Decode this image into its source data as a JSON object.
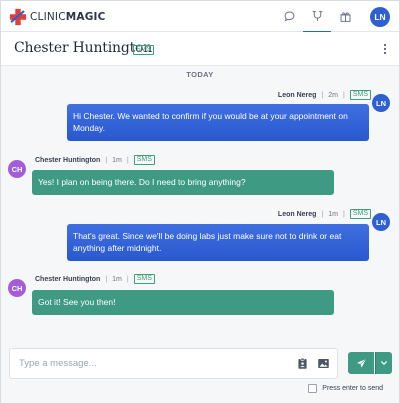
{
  "app": {
    "brand_prefix": "CLINIC",
    "brand_suffix": "MAGIC",
    "user_initials": "LN",
    "colors": {
      "primary": "#2563eb",
      "sms_green": "#3f9a84",
      "incoming_avatar": "#a45dd8"
    }
  },
  "nav": {
    "icons": [
      "chat-icon",
      "stethoscope-icon",
      "gift-icon"
    ],
    "active": "stethoscope-icon"
  },
  "header": {
    "contact_name": "Chester Huntington",
    "channel": "SMS"
  },
  "chat": {
    "day_label": "TODAY",
    "messages": [
      {
        "direction": "outgoing",
        "sender": "Leon Nereg",
        "time": "2m",
        "channel": "SMS",
        "initials": "LN",
        "text": "Hi Chester. We wanted to confirm if you would be at your appointment on Monday."
      },
      {
        "direction": "incoming",
        "sender": "Chester Huntington",
        "time": "1m",
        "channel": "SMS",
        "initials": "CH",
        "text": "Yes! I plan on being there. Do I need to bring anything?"
      },
      {
        "direction": "outgoing",
        "sender": "Leon Nereg",
        "time": "1m",
        "channel": "SMS",
        "initials": "LN",
        "text": "That's great. Since we'll be doing labs just make sure not to drink or eat anything after midnight."
      },
      {
        "direction": "incoming",
        "sender": "Chester Huntington",
        "time": "1m",
        "channel": "SMS",
        "initials": "CH",
        "text": "Got it! See you then!"
      }
    ]
  },
  "composer": {
    "placeholder": "Type a message...",
    "value": "",
    "enter_to_send_label": "Press enter to send",
    "enter_to_send_checked": false
  }
}
